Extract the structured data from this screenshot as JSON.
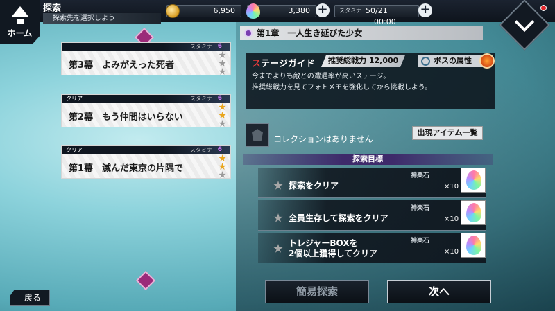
{
  "header": {
    "home_label": "ホーム",
    "title": "探索",
    "subtitle": "探索先を選択しよう"
  },
  "resources": {
    "coins": "6,950",
    "gems": "3,380",
    "stamina_label": "スタミナ",
    "stamina": "50/21",
    "timer": "00:00",
    "plus": "+"
  },
  "chapters": [
    {
      "header": "",
      "stamina_label": "スタミナ",
      "cost": "6",
      "title": "第3幕　よみがえった死者",
      "stars": [
        0,
        0,
        0
      ]
    },
    {
      "header": "クリア",
      "stamina_label": "スタミナ",
      "cost": "6",
      "title": "第2幕　もう仲間はいらない",
      "stars": [
        1,
        1,
        0
      ]
    },
    {
      "header": "クリア",
      "stamina_label": "スタミナ",
      "cost": "6",
      "title": "第1幕　滅んだ東京の片隅で",
      "stars": [
        1,
        1,
        0
      ]
    }
  ],
  "back_label": "戻る",
  "chapter_title": "第1章　一人生き延びた少女",
  "guide": {
    "title_first": "ス",
    "title_rest": "テージガイド",
    "power": "推奨総戦力 12,000",
    "boss": "ボスの属性",
    "desc1": "今までよりも敵との遭遇率が高いステージ。",
    "desc2": "推奨総戦力を見てフォトメモを強化してから挑戦しよう。"
  },
  "collection": {
    "text": "コレクションはありません",
    "items_button": "出現アイテム一覧"
  },
  "goals": {
    "header": "探索目標",
    "items": [
      {
        "text1": "探索をクリア",
        "text2": "",
        "reward": "神楽石",
        "count": "×10"
      },
      {
        "text1": "全員生存して探索をクリア",
        "text2": "",
        "reward": "神楽石",
        "count": "×10"
      },
      {
        "text1": "トレジャーBOXを",
        "text2": "2個以上獲得してクリア",
        "reward": "神楽石",
        "count": "×10"
      }
    ]
  },
  "buttons": {
    "quick": "簡易探索",
    "next": "次へ"
  }
}
